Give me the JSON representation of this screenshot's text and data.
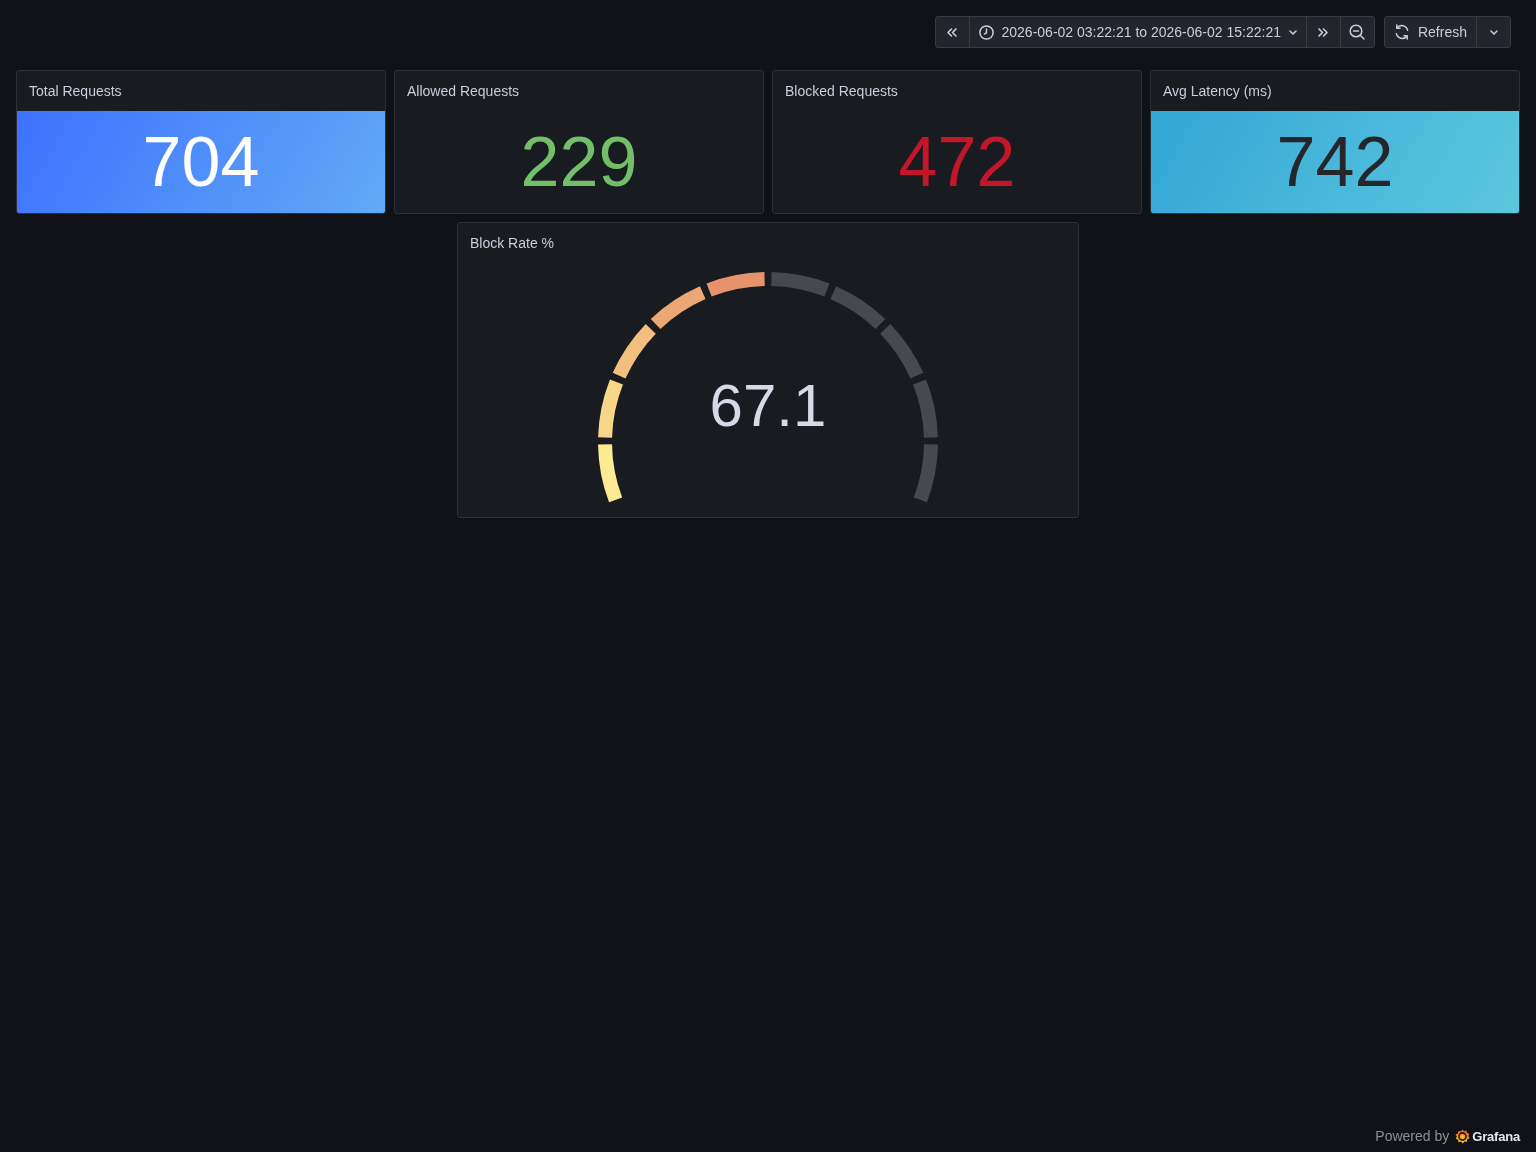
{
  "toolbar": {
    "time_range": "2026-06-02 03:22:21 to 2026-06-02 15:22:21",
    "refresh": "Refresh"
  },
  "panels": [
    {
      "title": "Total Requests",
      "value": "704",
      "kind": "background",
      "color": "#3d71ff"
    },
    {
      "title": "Allowed Requests",
      "value": "229",
      "kind": "value",
      "color": "#73bf69"
    },
    {
      "title": "Blocked Requests",
      "value": "472",
      "kind": "value",
      "color": "#c4162a"
    },
    {
      "title": "Avg Latency (ms)",
      "value": "742",
      "kind": "background",
      "color": "#33a6d6"
    }
  ],
  "gauge_panel": {
    "title": "Block Rate %",
    "value": "67.1",
    "level": 0.5
  },
  "footer": {
    "text": "Powered by",
    "brand": "Grafana"
  }
}
